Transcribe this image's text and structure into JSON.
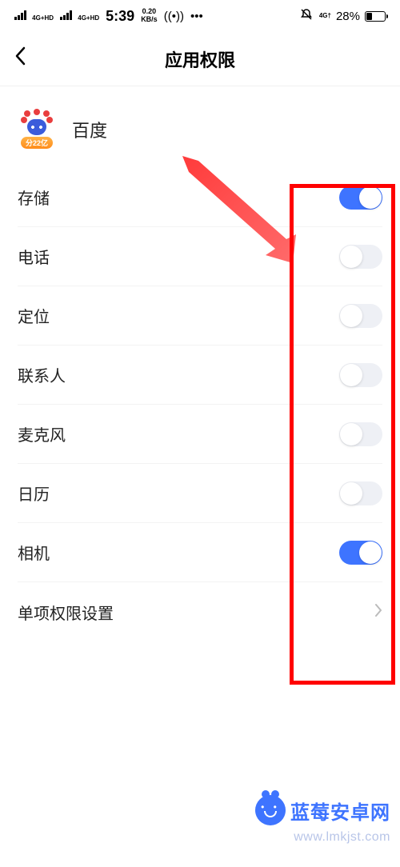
{
  "status": {
    "signal1_label": "4G+HD",
    "signal2_label": "4G+HD",
    "time": "5:39",
    "speed_top": "0.20",
    "speed_bottom": "KB/s",
    "right_net_label": "4G†",
    "battery_pct": "28%"
  },
  "header": {
    "title": "应用权限"
  },
  "app": {
    "name": "百度",
    "badge": "分22亿"
  },
  "permissions": [
    {
      "key": "storage",
      "label": "存储",
      "enabled": true,
      "type": "toggle"
    },
    {
      "key": "phone",
      "label": "电话",
      "enabled": false,
      "type": "toggle"
    },
    {
      "key": "location",
      "label": "定位",
      "enabled": false,
      "type": "toggle"
    },
    {
      "key": "contacts",
      "label": "联系人",
      "enabled": false,
      "type": "toggle"
    },
    {
      "key": "mic",
      "label": "麦克风",
      "enabled": false,
      "type": "toggle"
    },
    {
      "key": "calendar",
      "label": "日历",
      "enabled": false,
      "type": "toggle"
    },
    {
      "key": "camera",
      "label": "相机",
      "enabled": true,
      "type": "toggle"
    },
    {
      "key": "single",
      "label": "单项权限设置",
      "type": "nav"
    }
  ],
  "annotation": {
    "highlight_color": "#ff0000"
  },
  "watermark": {
    "brand": "蓝莓安卓网",
    "url": "www.lmkjst.com"
  }
}
